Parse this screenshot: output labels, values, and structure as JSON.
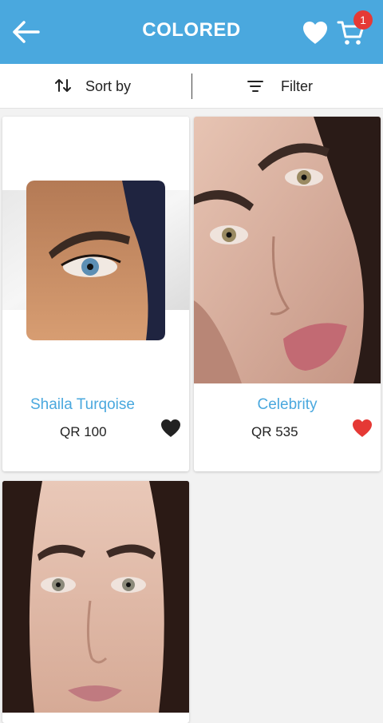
{
  "header": {
    "title": "COLORED",
    "cart_count": "1",
    "accent": "#4aa8de"
  },
  "toolbar": {
    "sort_label": "Sort by",
    "filter_label": "Filter"
  },
  "products": [
    {
      "name": "Shaila Turqoise",
      "price": "QR 100",
      "favorited": false
    },
    {
      "name": "Celebrity",
      "price": "QR 535",
      "favorited": true
    },
    {
      "name": "",
      "price": "",
      "favorited": false
    }
  ],
  "colors": {
    "favorite_active": "#e53935",
    "favorite_inactive": "#222222",
    "badge": "#e53935"
  }
}
